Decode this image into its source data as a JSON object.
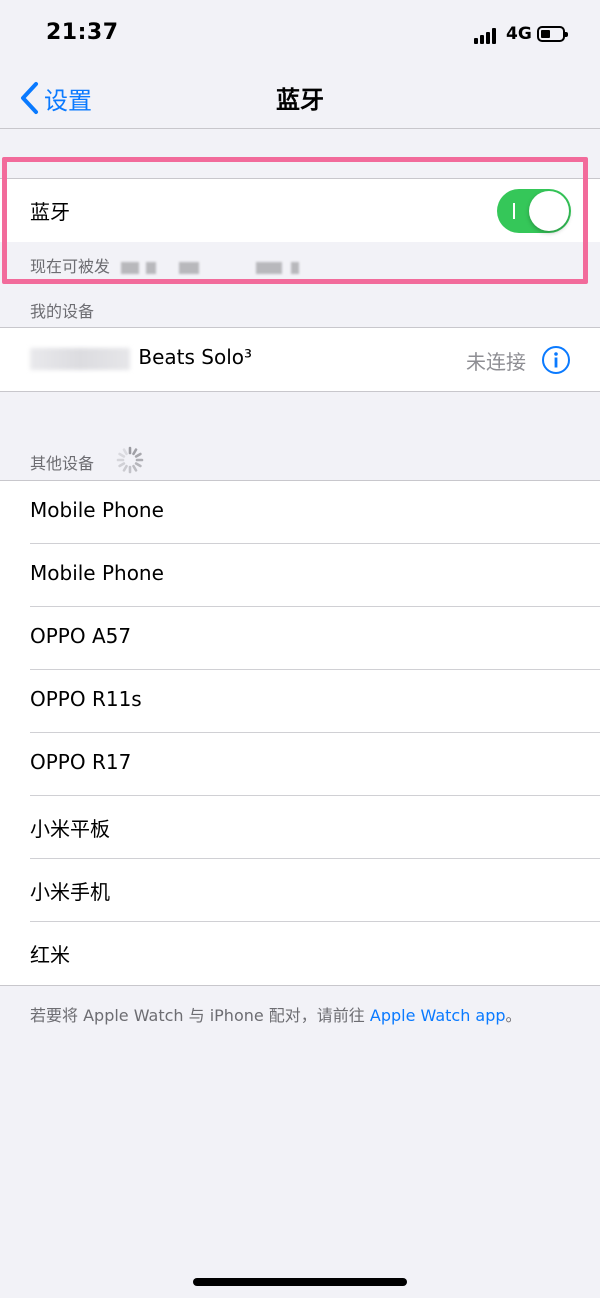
{
  "status_bar": {
    "time": "21:37",
    "network": "4G"
  },
  "nav": {
    "back_label": "设置",
    "title": "蓝牙"
  },
  "bluetooth": {
    "label": "蓝牙",
    "enabled": true,
    "discoverable_text": "现在可被发"
  },
  "my_devices": {
    "header": "我的设备",
    "items": [
      {
        "name": "Beats Solo³",
        "status": "未连接"
      }
    ]
  },
  "other_devices": {
    "header": "其他设备",
    "items": [
      {
        "name": "Mobile Phone"
      },
      {
        "name": "Mobile Phone"
      },
      {
        "name": "OPPO A57"
      },
      {
        "name": "OPPO R11s"
      },
      {
        "name": "OPPO R17"
      },
      {
        "name": "小米平板"
      },
      {
        "name": "小米手机"
      },
      {
        "name": "红米"
      }
    ]
  },
  "footer": {
    "prefix": "若要将 Apple Watch 与 iPhone 配对，请前往 ",
    "link": "Apple Watch app",
    "suffix": "。"
  },
  "colors": {
    "accent": "#0a7aff",
    "toggle_on": "#35c759",
    "highlight": "#f26b9b",
    "background": "#f2f2f7"
  }
}
